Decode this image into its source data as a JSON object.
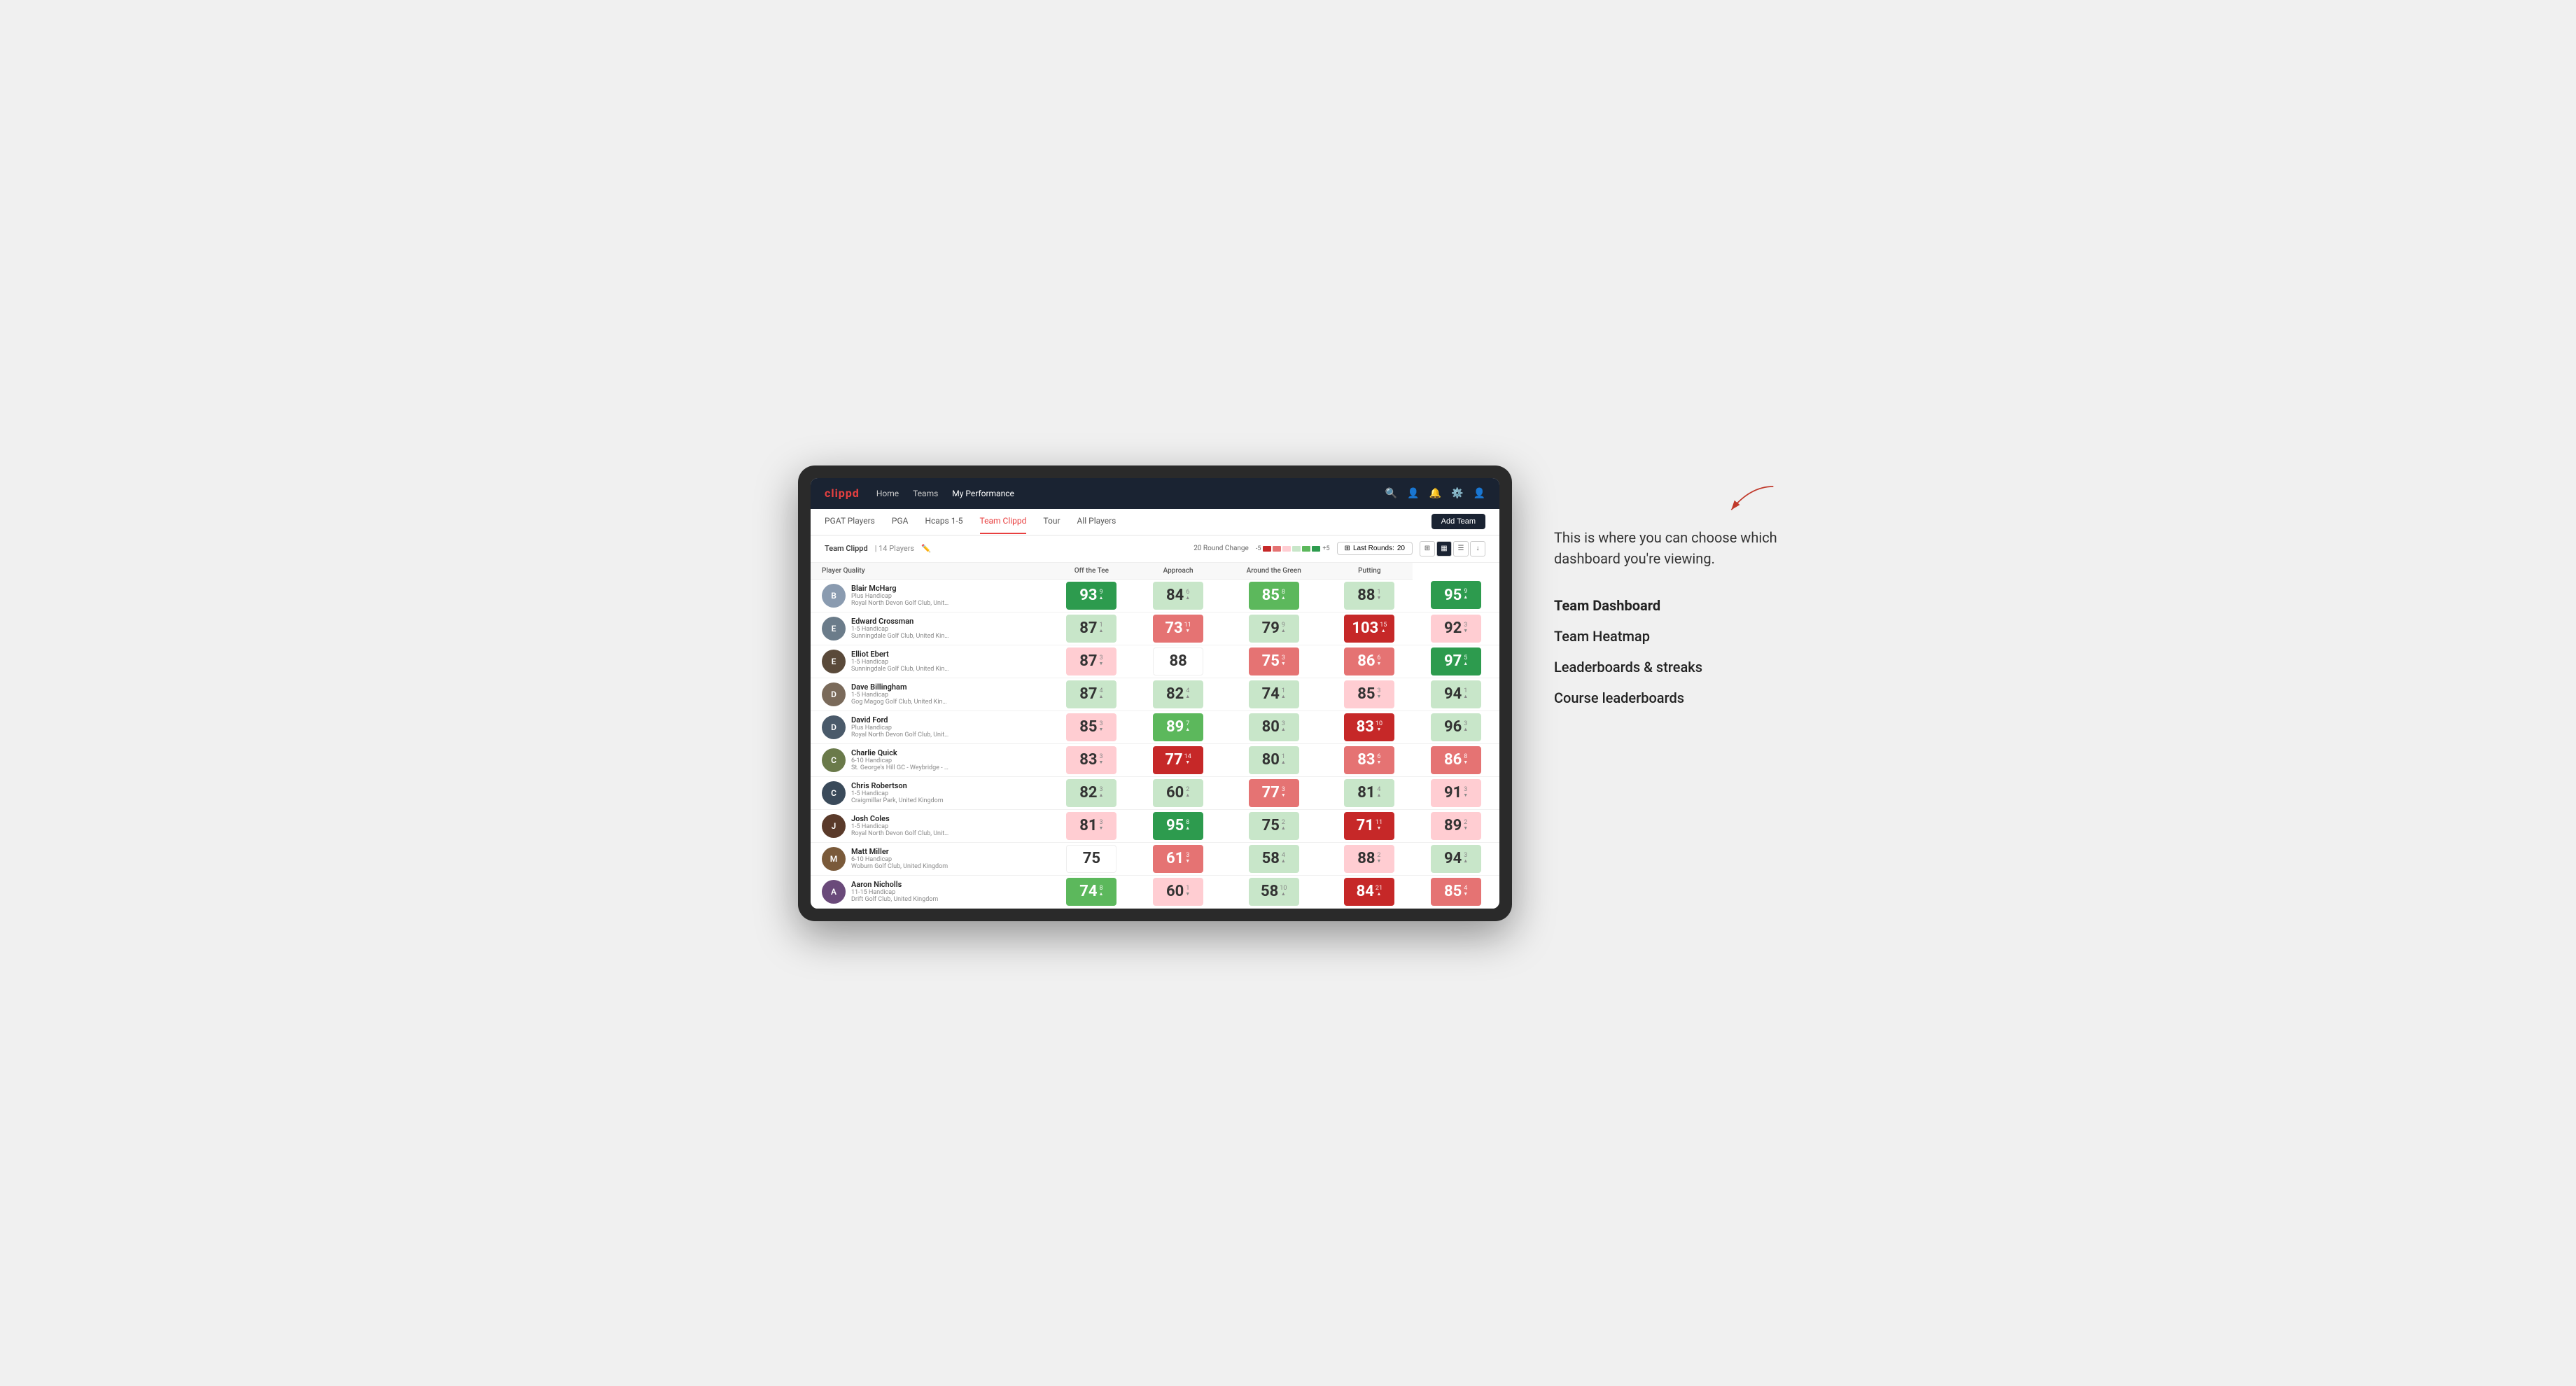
{
  "annotation": {
    "description": "This is where you can choose which dashboard you're viewing.",
    "menu_items": [
      {
        "label": "Team Dashboard",
        "active": true
      },
      {
        "label": "Team Heatmap",
        "active": false
      },
      {
        "label": "Leaderboards & streaks",
        "active": false
      },
      {
        "label": "Course leaderboards",
        "active": false
      }
    ]
  },
  "nav": {
    "logo": "clippd",
    "links": [
      "Home",
      "Teams",
      "My Performance"
    ],
    "active_link": "My Performance"
  },
  "sub_nav": {
    "links": [
      "PGAT Players",
      "PGA",
      "Hcaps 1-5",
      "Team Clippd",
      "Tour",
      "All Players"
    ],
    "active_link": "Team Clippd",
    "add_team_label": "Add Team"
  },
  "dashboard_header": {
    "team_name": "Team Clippd",
    "separator": "|",
    "player_count": "14 Players",
    "round_change_label": "20 Round Change",
    "round_change_min": "-5",
    "round_change_max": "+5",
    "last_rounds_label": "Last Rounds:",
    "last_rounds_value": "20"
  },
  "table": {
    "columns": [
      {
        "label": "Player Quality",
        "sort": true
      },
      {
        "label": "Off the Tee",
        "sort": true
      },
      {
        "label": "Approach",
        "sort": true
      },
      {
        "label": "Around the Green",
        "sort": true
      },
      {
        "label": "Putting",
        "sort": true
      }
    ],
    "rows": [
      {
        "name": "Blair McHarg",
        "handicap": "Plus Handicap",
        "club": "Royal North Devon Golf Club, United Kingdom",
        "avatar_color": "#8a9bb0",
        "avatar_initial": "B",
        "scores": [
          {
            "value": "93",
            "change": "9",
            "direction": "up",
            "color": "green-dark"
          },
          {
            "value": "84",
            "change": "6",
            "direction": "up",
            "color": "green-light"
          },
          {
            "value": "85",
            "change": "8",
            "direction": "up",
            "color": "green-mid"
          },
          {
            "value": "88",
            "change": "1",
            "direction": "down",
            "color": "green-light"
          },
          {
            "value": "95",
            "change": "9",
            "direction": "up",
            "color": "green-dark"
          }
        ]
      },
      {
        "name": "Edward Crossman",
        "handicap": "1-5 Handicap",
        "club": "Sunningdale Golf Club, United Kingdom",
        "avatar_color": "#6b7c8a",
        "avatar_initial": "E",
        "scores": [
          {
            "value": "87",
            "change": "1",
            "direction": "up",
            "color": "green-light"
          },
          {
            "value": "73",
            "change": "11",
            "direction": "down",
            "color": "red-mid"
          },
          {
            "value": "79",
            "change": "9",
            "direction": "up",
            "color": "green-light"
          },
          {
            "value": "103",
            "change": "15",
            "direction": "up",
            "color": "red-dark"
          },
          {
            "value": "92",
            "change": "3",
            "direction": "down",
            "color": "red-light"
          }
        ]
      },
      {
        "name": "Elliot Ebert",
        "handicap": "1-5 Handicap",
        "club": "Sunningdale Golf Club, United Kingdom",
        "avatar_color": "#5a4a3a",
        "avatar_initial": "E",
        "scores": [
          {
            "value": "87",
            "change": "3",
            "direction": "down",
            "color": "red-light"
          },
          {
            "value": "88",
            "change": "",
            "direction": "",
            "color": "white-bg"
          },
          {
            "value": "75",
            "change": "3",
            "direction": "down",
            "color": "red-mid"
          },
          {
            "value": "86",
            "change": "6",
            "direction": "down",
            "color": "red-mid"
          },
          {
            "value": "97",
            "change": "5",
            "direction": "up",
            "color": "green-dark"
          }
        ]
      },
      {
        "name": "Dave Billingham",
        "handicap": "1-5 Handicap",
        "club": "Gog Magog Golf Club, United Kingdom",
        "avatar_color": "#7a6a5a",
        "avatar_initial": "D",
        "scores": [
          {
            "value": "87",
            "change": "4",
            "direction": "up",
            "color": "green-light"
          },
          {
            "value": "82",
            "change": "4",
            "direction": "up",
            "color": "green-light"
          },
          {
            "value": "74",
            "change": "1",
            "direction": "up",
            "color": "green-light"
          },
          {
            "value": "85",
            "change": "3",
            "direction": "down",
            "color": "red-light"
          },
          {
            "value": "94",
            "change": "1",
            "direction": "up",
            "color": "green-light"
          }
        ]
      },
      {
        "name": "David Ford",
        "handicap": "Plus Handicap",
        "club": "Royal North Devon Golf Club, United Kingdom",
        "avatar_color": "#4a5a6a",
        "avatar_initial": "D",
        "verified": true,
        "scores": [
          {
            "value": "85",
            "change": "3",
            "direction": "down",
            "color": "red-light"
          },
          {
            "value": "89",
            "change": "7",
            "direction": "up",
            "color": "green-mid"
          },
          {
            "value": "80",
            "change": "3",
            "direction": "up",
            "color": "green-light"
          },
          {
            "value": "83",
            "change": "10",
            "direction": "down",
            "color": "red-dark"
          },
          {
            "value": "96",
            "change": "3",
            "direction": "up",
            "color": "green-light"
          }
        ]
      },
      {
        "name": "Charlie Quick",
        "handicap": "6-10 Handicap",
        "club": "St. George's Hill GC - Weybridge - Surrey, Uni...",
        "avatar_color": "#6a7a4a",
        "avatar_initial": "C",
        "verified": true,
        "scores": [
          {
            "value": "83",
            "change": "3",
            "direction": "down",
            "color": "red-light"
          },
          {
            "value": "77",
            "change": "14",
            "direction": "down",
            "color": "red-dark"
          },
          {
            "value": "80",
            "change": "1",
            "direction": "up",
            "color": "green-light"
          },
          {
            "value": "83",
            "change": "6",
            "direction": "down",
            "color": "red-mid"
          },
          {
            "value": "86",
            "change": "8",
            "direction": "down",
            "color": "red-mid"
          }
        ]
      },
      {
        "name": "Chris Robertson",
        "handicap": "1-5 Handicap",
        "club": "Craigmillar Park, United Kingdom",
        "avatar_color": "#3a4a5a",
        "avatar_initial": "C",
        "verified": true,
        "scores": [
          {
            "value": "82",
            "change": "3",
            "direction": "up",
            "color": "green-light"
          },
          {
            "value": "60",
            "change": "2",
            "direction": "up",
            "color": "green-light"
          },
          {
            "value": "77",
            "change": "3",
            "direction": "down",
            "color": "red-mid"
          },
          {
            "value": "81",
            "change": "4",
            "direction": "up",
            "color": "green-light"
          },
          {
            "value": "91",
            "change": "3",
            "direction": "down",
            "color": "red-light"
          }
        ]
      },
      {
        "name": "Josh Coles",
        "handicap": "1-5 Handicap",
        "club": "Royal North Devon Golf Club, United Kingdom",
        "avatar_color": "#5a3a2a",
        "avatar_initial": "J",
        "scores": [
          {
            "value": "81",
            "change": "3",
            "direction": "down",
            "color": "red-light"
          },
          {
            "value": "95",
            "change": "8",
            "direction": "up",
            "color": "green-dark"
          },
          {
            "value": "75",
            "change": "2",
            "direction": "up",
            "color": "green-light"
          },
          {
            "value": "71",
            "change": "11",
            "direction": "down",
            "color": "red-dark"
          },
          {
            "value": "89",
            "change": "2",
            "direction": "down",
            "color": "red-light"
          }
        ]
      },
      {
        "name": "Matt Miller",
        "handicap": "6-10 Handicap",
        "club": "Woburn Golf Club, United Kingdom",
        "avatar_color": "#7a5a3a",
        "avatar_initial": "M",
        "scores": [
          {
            "value": "75",
            "change": "",
            "direction": "",
            "color": "white-bg"
          },
          {
            "value": "61",
            "change": "3",
            "direction": "down",
            "color": "red-mid"
          },
          {
            "value": "58",
            "change": "4",
            "direction": "up",
            "color": "green-light"
          },
          {
            "value": "88",
            "change": "2",
            "direction": "down",
            "color": "red-light"
          },
          {
            "value": "94",
            "change": "3",
            "direction": "up",
            "color": "green-light"
          }
        ]
      },
      {
        "name": "Aaron Nicholls",
        "handicap": "11-15 Handicap",
        "club": "Drift Golf Club, United Kingdom",
        "avatar_color": "#6a4a7a",
        "avatar_initial": "A",
        "scores": [
          {
            "value": "74",
            "change": "8",
            "direction": "up",
            "color": "green-mid"
          },
          {
            "value": "60",
            "change": "1",
            "direction": "down",
            "color": "red-light"
          },
          {
            "value": "58",
            "change": "10",
            "direction": "up",
            "color": "green-light"
          },
          {
            "value": "84",
            "change": "21",
            "direction": "up",
            "color": "red-dark"
          },
          {
            "value": "85",
            "change": "4",
            "direction": "down",
            "color": "red-mid"
          }
        ]
      }
    ]
  }
}
